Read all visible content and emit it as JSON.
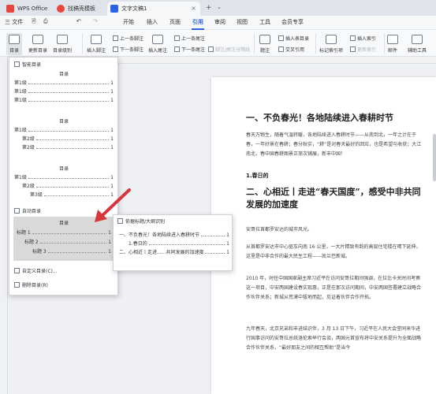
{
  "tabs": [
    {
      "label": "WPS Office",
      "color": "#e8453c"
    },
    {
      "label": "找稿壳模板",
      "color": "#e8453c"
    },
    {
      "label": "文字文稿1",
      "color": "#2b62e3"
    }
  ],
  "menubar": {
    "file": "三 文件",
    "items": [
      "开始",
      "插入",
      "页面",
      "引用",
      "审阅",
      "视图",
      "工具",
      "会员专享"
    ],
    "active": "引用"
  },
  "ribbon": {
    "toc": "目录",
    "update_toc": "更新目录",
    "toc_level": "目录级别",
    "insert_footnote": "插入脚注",
    "prev_footnote": "上一条脚注",
    "next_footnote": "下一条脚注",
    "insert_endnote": "插入尾注",
    "prev_endnote": "上一条尾注",
    "next_endnote": "下一条尾注",
    "footnote_endnote_sep": "脚注/尾注分隔线",
    "caption": "题注",
    "insert_table_of_figures": "插入表目录",
    "cross_ref": "交叉引用",
    "mark_index": "标记索引项",
    "insert_index": "插入索引",
    "update_index": "更新索引",
    "mail": "邮件",
    "doc_tools": "辅助工具"
  },
  "panel": {
    "smart_toc": "智能目录",
    "blocks": [
      {
        "title": "目录",
        "lines": [
          {
            "label": "第1级",
            "num": "1"
          },
          {
            "label": "第1级",
            "num": "1"
          },
          {
            "label": "第1级",
            "num": "1"
          }
        ]
      },
      {
        "title": "目录",
        "lines": [
          {
            "label": "第1级",
            "num": "1"
          },
          {
            "label": "第2级",
            "num": "1"
          },
          {
            "label": "第2级",
            "num": "1"
          }
        ]
      },
      {
        "title": "目录",
        "lines": [
          {
            "label": "第1级",
            "num": "1"
          },
          {
            "label": "第2级",
            "num": "1"
          },
          {
            "label": "第3级",
            "num": "1"
          }
        ]
      }
    ],
    "auto_toc": "自动目录",
    "auto_block": {
      "title": "目录",
      "lines": [
        {
          "label": "标题 1",
          "num": "1"
        },
        {
          "label": "标题 2",
          "num": "1"
        },
        {
          "label": "标题 3",
          "num": "1"
        }
      ]
    },
    "custom_toc": "自定义目录(C)...",
    "delete_toc": "删除目录(R)"
  },
  "popup": {
    "title": "依据标题/大纲识别",
    "lines": [
      {
        "label": "一、不负春光！各地陆续进入春耕时节",
        "num": "1"
      },
      {
        "label": "1.春日的",
        "num": "1"
      },
      {
        "label": "二、心相近丨走进......共同发展的加速度",
        "num": "1"
      }
    ]
  },
  "doc": {
    "heading1": "一、不负春光！各地陆续进入春耕时节",
    "para1": "春天万物生，随着气温转暖，各地陆续进入春耕时节——从南到北，一年之计在于春，一年好景在春耕；春分秋实，“耕”是对春天最好的回应，也是希望与收获；大江南北，春中国春耕图景正渐次铺展，新丰中国！",
    "heading2": "1.春日的",
    "heading3": "二、心相近丨走进“春天国度”，感受中非共同发展的加速度",
    "para2": "安哥拉首都罗安达的城市风光。",
    "para3": "从首都罗安达市中心驱车向南 16 公里，一大片精致有韵的高层住宅楼在晴下延伸，这里是中非合作的最大民生工程——凯兰巴新城。",
    "para4": "2010 年，时任中国国家副主席习近平在访问安哥拉期间强调，在拉比卡关时间考察这一项目，中安两国建设春实现惠，正是在那次访问期间，中安两国签署建立战略合作伙伴关系；新城从荒漠中拔地而起，见证着伙伴合作开拓。",
    "para5": "九年春天，北京兄弟和丰进结识伴，3 月 13 日下午，习近平在人民大会堂同来华进行国事访问的安哥拉总统洛伦索举行会谈，两国元首宣布将中安关系提升为全面战略合作伙伴关系，“最好朋友之间的相互帮助”是当今"
  },
  "colors": {
    "accent": "#2b62e3",
    "arrow": "#d6363c"
  }
}
